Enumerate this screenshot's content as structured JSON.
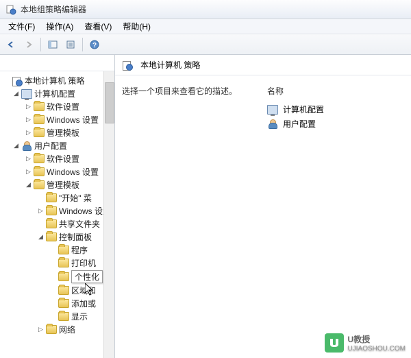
{
  "window": {
    "title": "本地组策略编辑器"
  },
  "menu": {
    "file": "文件(F)",
    "action": "操作(A)",
    "view": "查看(V)",
    "help": "帮助(H)"
  },
  "tree": {
    "root": "本地计算机 策略",
    "computer_config": "计算机配置",
    "software_settings": "软件设置",
    "windows_settings": "Windows 设置",
    "admin_templates": "管理模板",
    "user_config": "用户配置",
    "start_menu": "\"开始\" 菜",
    "shared_folders": "共享文件夹",
    "control_panel": "控制面板",
    "programs": "程序",
    "printers": "打印机",
    "personalization": "个性化",
    "region": "区域和",
    "add_remove": "添加或",
    "display": "显示",
    "network": "网络"
  },
  "content": {
    "header": "本地计算机 策略",
    "description": "选择一个项目来查看它的描述。",
    "name_header": "名称",
    "item_computer": "计算机配置",
    "item_user": "用户配置"
  },
  "watermark": {
    "name": "U教授",
    "url": "UJIAOSHOU.COM"
  }
}
